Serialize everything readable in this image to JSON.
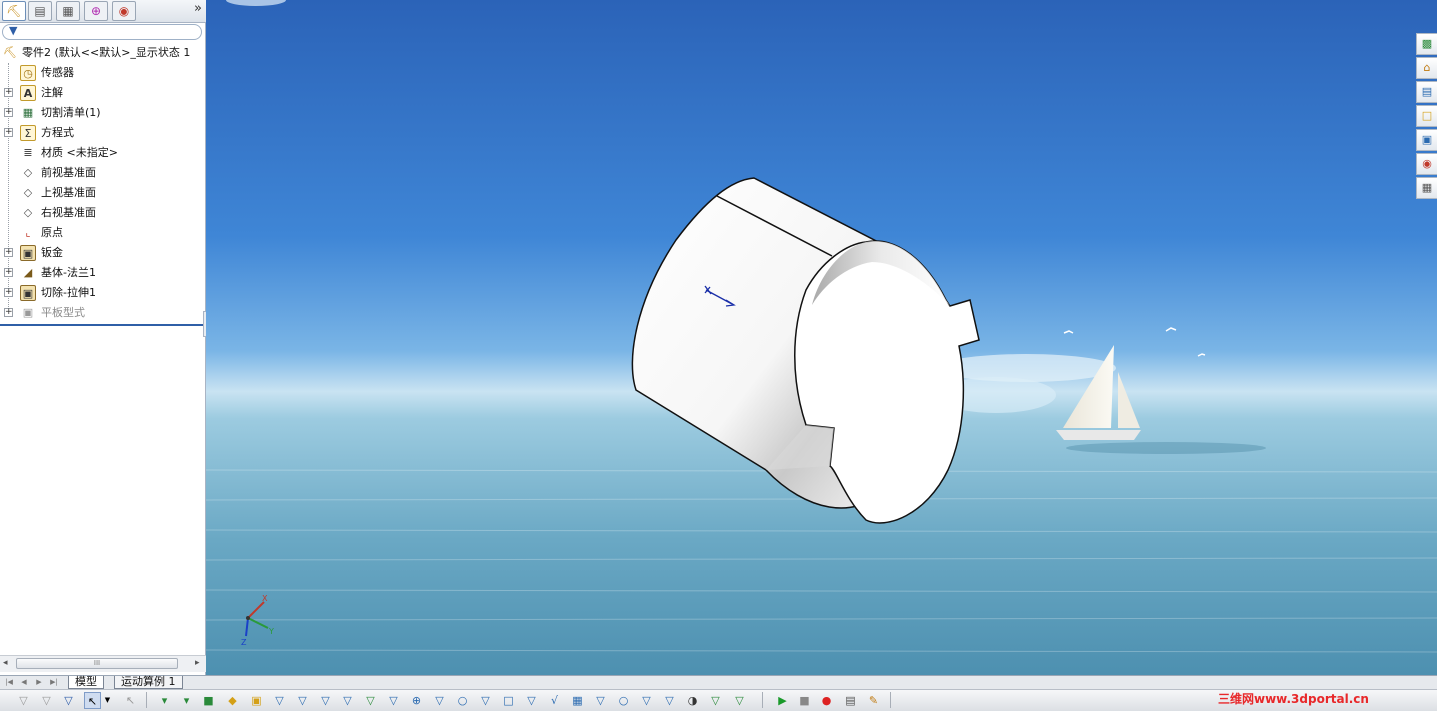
{
  "panel": {
    "tabs": [
      {
        "name": "feature-manager-tab",
        "icon": "part-tree-icon"
      },
      {
        "name": "property-manager-tab",
        "icon": "property-icon"
      },
      {
        "name": "configuration-manager-tab",
        "icon": "configuration-icon"
      },
      {
        "name": "dimxpert-tab",
        "icon": "crosshair-icon"
      },
      {
        "name": "display-manager-tab",
        "icon": "appearance-icon"
      }
    ],
    "expand_label": "»",
    "filter_icon": "filter-icon"
  },
  "tree": {
    "root": "零件2 (默认<<默认>_显示状态 1",
    "items": [
      {
        "label": "传感器",
        "icon": "sensor-icon",
        "expandable": false
      },
      {
        "label": "注解",
        "icon": "annotation-icon",
        "expandable": true
      },
      {
        "label": "切割清单(1)",
        "icon": "cut-list-icon",
        "expandable": true
      },
      {
        "label": "方程式",
        "icon": "equation-icon",
        "expandable": true
      },
      {
        "label": "材质 <未指定>",
        "icon": "material-icon",
        "expandable": false
      },
      {
        "label": "前视基准面",
        "icon": "plane-icon",
        "expandable": false
      },
      {
        "label": "上视基准面",
        "icon": "plane-icon",
        "expandable": false
      },
      {
        "label": "右视基准面",
        "icon": "plane-icon",
        "expandable": false
      },
      {
        "label": "原点",
        "icon": "origin-icon",
        "expandable": false
      },
      {
        "label": "钣金",
        "icon": "sheet-metal-icon",
        "expandable": true
      },
      {
        "label": "基体-法兰1",
        "icon": "base-flange-icon",
        "expandable": true
      },
      {
        "label": "切除-拉伸1",
        "icon": "cut-extrude-icon",
        "expandable": true
      },
      {
        "label": "平板型式",
        "icon": "flat-pattern-icon",
        "expandable": true,
        "suppressed": true
      }
    ]
  },
  "scrollbar": {
    "left": "◂",
    "right": "▸",
    "grip": "III"
  },
  "bottom_tabs": [
    "模型",
    "运动算例 1"
  ],
  "triad": {
    "x": "X",
    "y": "Y",
    "z": "Z"
  },
  "taskpane": [
    "resources-icon",
    "home-icon",
    "design-library-icon",
    "file-explorer-icon",
    "view-palette-icon",
    "appearances-icon",
    "custom-properties-icon"
  ],
  "toolbar_icons": [
    "filter-toggle-icon",
    "filter-faces-icon",
    "filter-edges-icon",
    "select-arrow-icon",
    "select-dropdown-icon",
    "select-other-icon",
    "filter-vertices-icon",
    "filter-sketch-icon",
    "filter-solid-icon",
    "filter-surface-icon",
    "filter-planes-icon",
    "filter-axes-icon",
    "filter-points-icon",
    "filter-sketch-segments-icon",
    "filter-midpoints-icon",
    "filter-center-marks-icon",
    "filter-centerlines-icon",
    "filter-dimensions-icon",
    "filter-notes-icon",
    "filter-balloons-icon",
    "filter-weld-icon",
    "filter-datum-icon",
    "filter-geometric-tol-icon",
    "filter-surface-finish-icon",
    "filter-blocks-icon",
    "filter-cosmetic-thread-icon",
    "filter-dowel-pin-icon",
    "filter-connection-points-icon",
    "filter-routing-points-icon",
    "filter-mates-icon",
    "filter-misc-icon"
  ],
  "macro_icons": [
    "play-macro-icon",
    "stop-macro-icon",
    "record-macro-icon",
    "new-macro-icon",
    "edit-macro-icon"
  ],
  "watermark": "三维网www.3dportal.cn",
  "colors": {
    "sky_top": "#2f6cc4",
    "sky_mid": "#5b9be0",
    "horizon": "#c7e2f2",
    "sea": "#7fb3cc",
    "part": "#ffffff",
    "accent": "#2f5fa7",
    "watermark": "#e8282a"
  }
}
